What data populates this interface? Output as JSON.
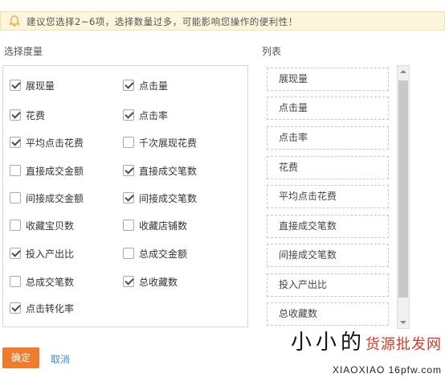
{
  "notice": {
    "text": "建议您选择2~6项，选择数量过多，可能影响您操作的便利性！",
    "icon": "bell-icon"
  },
  "metrics_panel": {
    "title": "选择度量",
    "options": [
      {
        "label": "展现量",
        "checked": true
      },
      {
        "label": "点击量",
        "checked": true
      },
      {
        "label": "花费",
        "checked": true
      },
      {
        "label": "点击率",
        "checked": true
      },
      {
        "label": "平均点击花费",
        "checked": true
      },
      {
        "label": "千次展现花费",
        "checked": false
      },
      {
        "label": "直接成交金额",
        "checked": false
      },
      {
        "label": "直接成交笔数",
        "checked": true
      },
      {
        "label": "间接成交金额",
        "checked": false
      },
      {
        "label": "间接成交笔数",
        "checked": true
      },
      {
        "label": "收藏宝贝数",
        "checked": false
      },
      {
        "label": "收藏店铺数",
        "checked": false
      },
      {
        "label": "投入产出比",
        "checked": true
      },
      {
        "label": "总成交金额",
        "checked": false
      },
      {
        "label": "总成交笔数",
        "checked": false
      },
      {
        "label": "总收藏数",
        "checked": true
      },
      {
        "label": "点击转化率",
        "checked": true
      }
    ]
  },
  "list_panel": {
    "title": "列表",
    "items": [
      "展现量",
      "点击量",
      "点击率",
      "花费",
      "平均点击花费",
      "直接成交笔数",
      "间接成交笔数",
      "投入产出比",
      "总收藏数"
    ]
  },
  "actions": {
    "confirm_label": "确定",
    "cancel_label": "取消"
  },
  "watermark": {
    "cn_black": "小小的",
    "cn_red": "货源批发网",
    "en": "XIAOXIAO 16pfw.com"
  },
  "colors": {
    "accent": "#f07b2d",
    "link": "#3c86d8",
    "notice_bg": "#fdf6dc"
  }
}
